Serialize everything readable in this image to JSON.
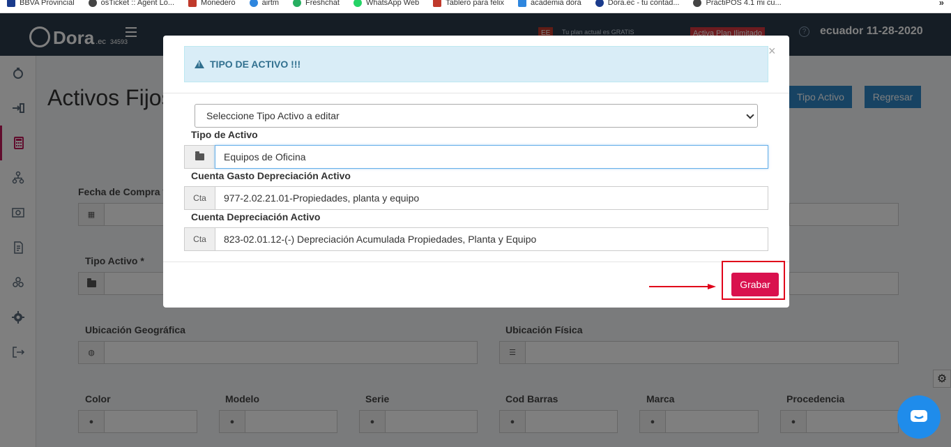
{
  "bookmarks": [
    {
      "label": "BBVA Provincial",
      "color": "#1a3b8c"
    },
    {
      "label": "osTicket :: Agent Lo...",
      "color": "#444444"
    },
    {
      "label": "Monedero",
      "color": "#c0392b"
    },
    {
      "label": "airtm",
      "color": "#2e86de"
    },
    {
      "label": "Freshchat",
      "color": "#27ae60"
    },
    {
      "label": "WhatsApp Web",
      "color": "#25d366"
    },
    {
      "label": "Tablero para felix",
      "color": "#c0392b"
    },
    {
      "label": "academia dora",
      "color": "#2e86de"
    },
    {
      "label": "Dora.ec - tu contad...",
      "color": "#1a3b8c"
    },
    {
      "label": "PractiPOS 4.1 mi cu...",
      "color": "#444444"
    }
  ],
  "bookmarks_more": "»",
  "navbar": {
    "logo_text": "Dora",
    "logo_suffix": ".ec",
    "logo_number": "34593",
    "ee_badge": "EE",
    "plan_text": "Tu plan actual es GRATIS",
    "activa_text": "Activa Plan Ilimitado",
    "help_icon": "?",
    "date_text": "ecuador 11-28-2020"
  },
  "page": {
    "title": "Activos Fijos",
    "tipo_activo_button": "Tipo Activo",
    "regresar_button": "Regresar",
    "fecha_compra_label": "Fecha de Compra *",
    "tipo_activo_label": "Tipo Activo *",
    "ubicacion_geo_label": "Ubicación Geográfica",
    "ubicacion_fisica_label": "Ubicación Física",
    "color_label": "Color",
    "modelo_label": "Modelo",
    "serie_label": "Serie",
    "cod_barras_label": "Cod Barras",
    "marca_label": "Marca",
    "procedencia_label": "Procedencia"
  },
  "modal": {
    "alert_title": "TIPO DE ACTIVO !!!",
    "close_label": "×",
    "select_value": "Seleccione Tipo Activo a editar",
    "tipo_label": "Tipo de Activo",
    "tipo_value": "Equipos de Oficina",
    "gasto_label": "Cuenta Gasto Depreciación Activo",
    "gasto_addon": "Cta",
    "gasto_value": "977-2.02.21.01-Propiedades, planta y equipo",
    "dep_label": "Cuenta Depreciación Activo",
    "dep_addon": "Cta",
    "dep_value": "823-02.01.12-(-) Depreciación Acumulada Propiedades, Planta y Equipo",
    "save_button": "Grabar"
  },
  "colors": {
    "navbar": "#2b3a4a",
    "accent_blue": "#2f86c6",
    "save_button": "#d9114e",
    "highlight": "#e0001a",
    "alert_bg": "#d9edf7"
  }
}
